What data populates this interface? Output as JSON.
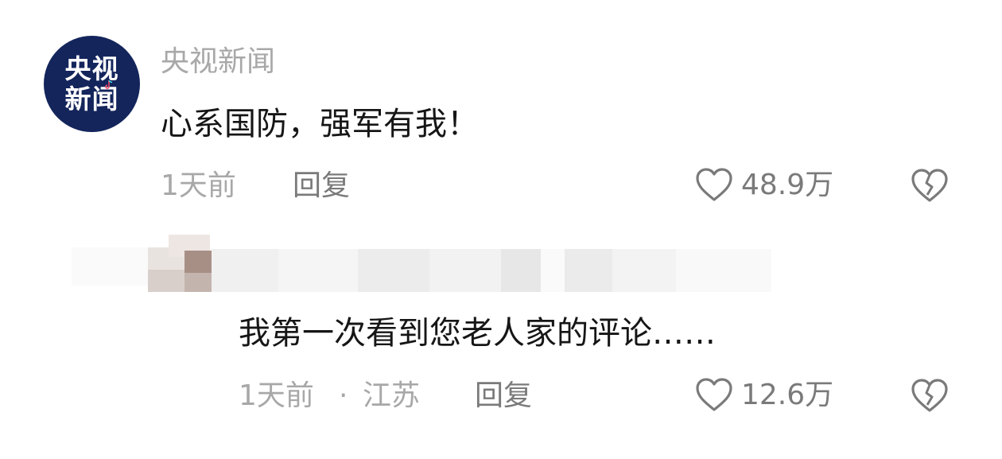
{
  "comment": {
    "avatar": {
      "line1": "央视",
      "line2": "新闻"
    },
    "username": "央视新闻",
    "content": "心系国防，强军有我！",
    "time": "1天前",
    "reply_label": "回复",
    "likes": "48.9万"
  },
  "reply": {
    "content": "我第一次看到您老人家的评论……",
    "time": "1天前",
    "separator": "·",
    "location": "江苏",
    "reply_label": "回复",
    "likes": "12.6万"
  },
  "icons": {
    "like": "heart-outline-icon",
    "dislike": "broken-heart-icon"
  },
  "colors": {
    "avatar_bg": "#14255c",
    "muted_text": "#a8a8a8",
    "main_text": "#161616"
  }
}
